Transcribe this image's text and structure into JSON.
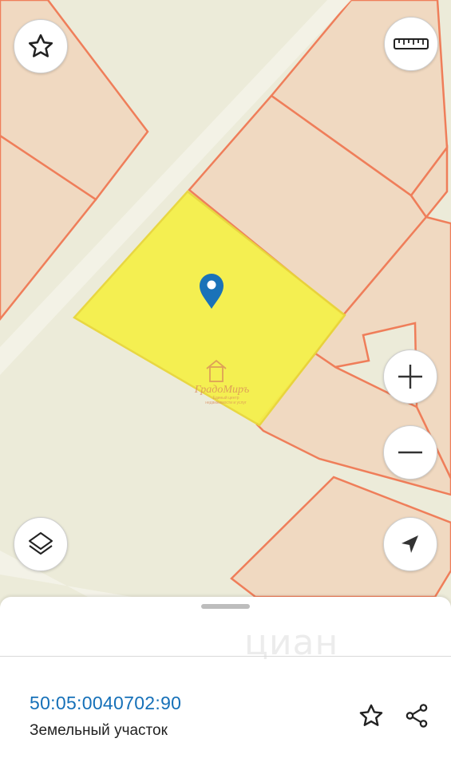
{
  "map": {
    "colors": {
      "background": "#ecebd9",
      "road": "#f2f1e5",
      "parcel_fill": "#f0d9c1",
      "parcel_border": "#ef7e5a",
      "selected_fill": "#f5f04a",
      "selected_border": "#e8d63a",
      "pin": "#1a72b8"
    },
    "watermark": {
      "brand": "ГрадоМиръ",
      "tagline_1": "Единый центр",
      "tagline_2": "недвижимости и услуг"
    },
    "controls": {
      "favorite": "star-icon",
      "ruler": "ruler-icon",
      "zoom_in": "plus-icon",
      "zoom_out": "minus-icon",
      "layers": "layers-icon",
      "locate": "navigation-arrow-icon"
    }
  },
  "sheet": {
    "watermark": "циан",
    "cadastral_number": "50:05:0040702:90",
    "parcel_type": "Земельный участок",
    "actions": {
      "favorite": "star-icon",
      "share": "share-icon"
    }
  }
}
